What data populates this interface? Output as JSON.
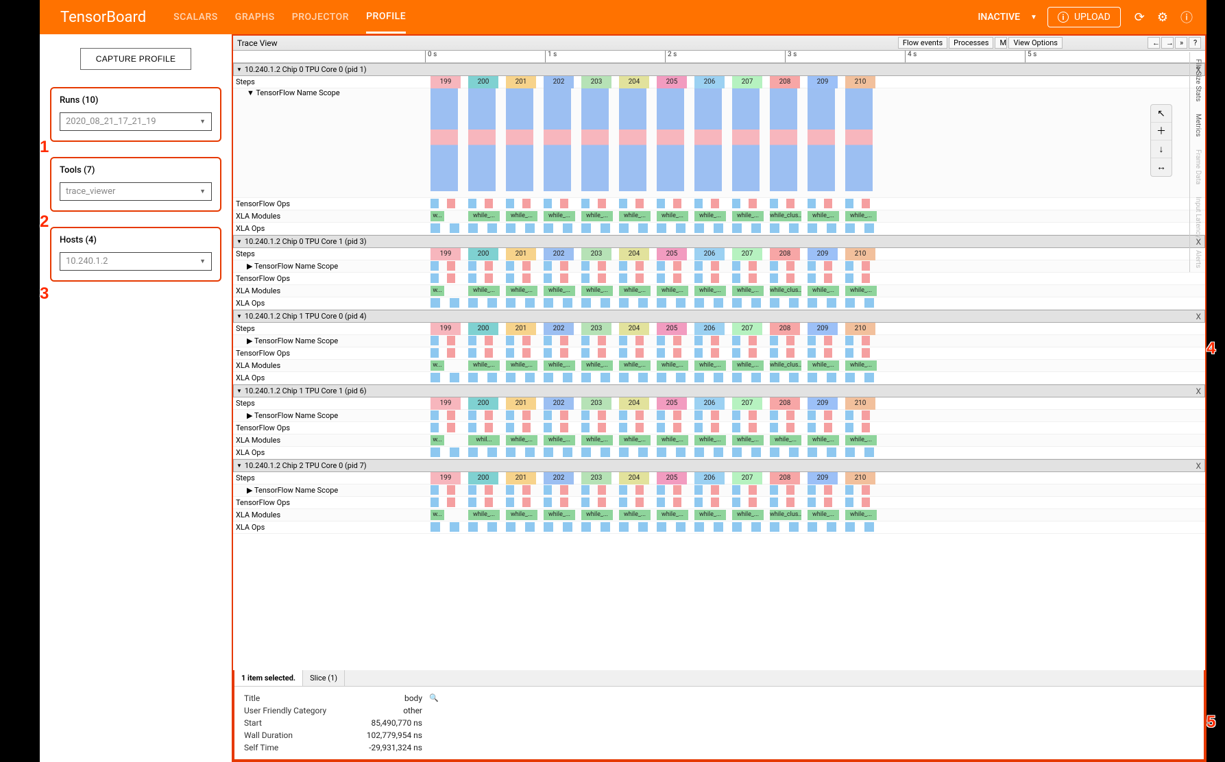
{
  "header": {
    "logo": "TensorBoard",
    "nav": [
      "SCALARS",
      "GRAPHS",
      "PROJECTOR",
      "PROFILE"
    ],
    "active_nav": "PROFILE",
    "status_dropdown": "INACTIVE",
    "upload": "UPLOAD"
  },
  "sidebar": {
    "capture": "CAPTURE PROFILE",
    "runs_label": "Runs (10)",
    "runs_value": "2020_08_21_17_21_19",
    "tools_label": "Tools (7)",
    "tools_value": "trace_viewer",
    "hosts_label": "Hosts (4)",
    "hosts_value": "10.240.1.2"
  },
  "trace": {
    "title": "Trace View",
    "buttons": [
      "Flow events",
      "Processes",
      "M",
      "View Options",
      "←",
      "→",
      "»",
      "?"
    ],
    "ticks": [
      "0 s",
      "1 s",
      "2 s",
      "3 s",
      "4 s",
      "5 s"
    ],
    "pids": [
      "10.240.1.2 Chip 0 TPU Core 0 (pid 1)",
      "10.240.1.2 Chip 0 TPU Core 1 (pid 3)",
      "10.240.1.2 Chip 1 TPU Core 0 (pid 4)",
      "10.240.1.2 Chip 1 TPU Core 1 (pid 6)",
      "10.240.1.2 Chip 2 TPU Core 0 (pid 7)"
    ],
    "close": "X",
    "row_labels": {
      "steps": "Steps",
      "name_scope": "TensorFlow Name Scope",
      "tf_ops": "TensorFlow Ops",
      "xla_modules": "XLA Modules",
      "xla_ops": "XLA Ops"
    },
    "step_nums": [
      "199",
      "200",
      "201",
      "202",
      "203",
      "204",
      "205",
      "206",
      "207",
      "208",
      "209",
      "210"
    ],
    "xla_labels": [
      "w...",
      "while_...",
      "while_...",
      "while_...",
      "while_...",
      "while_...",
      "while_...",
      "while_...",
      "while_...",
      "while_clus...",
      "while_...",
      "while_..."
    ],
    "xla_labels_alt": [
      "w...",
      "whil...",
      "while_...",
      "while_...",
      "while_...",
      "while_...",
      "while_...",
      "while_...",
      "while_...",
      "while_...",
      "while_...",
      "while_..."
    ],
    "right_tabs": [
      "File Size Stats",
      "Metrics",
      "Frame Data",
      "Input Latency",
      "Alerts"
    ],
    "tools": [
      "↖",
      "＋",
      "↓",
      "↔"
    ]
  },
  "detail": {
    "sel_label": "1 item selected.",
    "tab": "Slice (1)",
    "rows": [
      {
        "k": "Title",
        "v": "body",
        "mag": true
      },
      {
        "k": "User Friendly Category",
        "v": "other"
      },
      {
        "k": "Start",
        "v": "85,490,770 ns"
      },
      {
        "k": "Wall Duration",
        "v": "102,779,954 ns"
      },
      {
        "k": "Self Time",
        "v": "-29,931,324 ns"
      }
    ]
  },
  "annotations": [
    "1",
    "2",
    "3",
    "4",
    "5"
  ]
}
